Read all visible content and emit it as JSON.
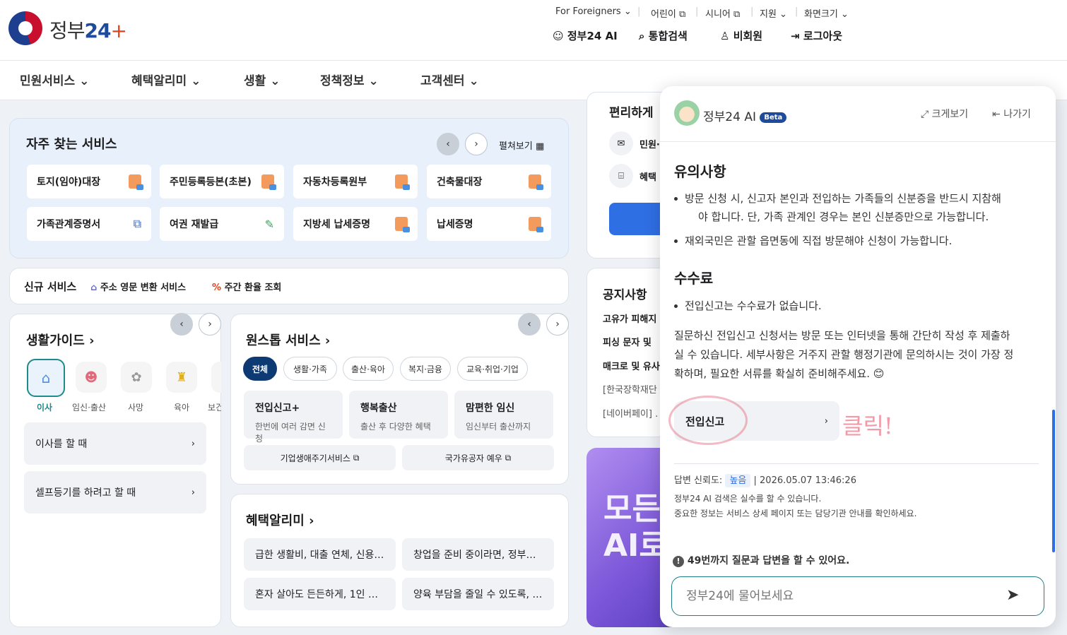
{
  "header": {
    "brand_text": "정부",
    "brand_num": "24",
    "brand_plus": "+",
    "util": [
      "For Foreigners",
      "어린이",
      "시니어",
      "지원",
      "화면크기"
    ],
    "main": [
      "정부24 AI",
      "통합검색",
      "비회원",
      "로그아웃"
    ]
  },
  "gnb": [
    "민원서비스",
    "혜택알리미",
    "생활",
    "정책정보",
    "고객센터"
  ],
  "fav": {
    "title": "자주 찾는 서비스",
    "expand": "펼쳐보기",
    "tiles": [
      "토지(임야)대장",
      "주민등록등본(초본)",
      "자동차등록원부",
      "건축물대장",
      "가족관계증명서",
      "여권 재발급",
      "지방세 납세증명",
      "납세증명"
    ]
  },
  "newsvc": {
    "label": "신규 서비스",
    "items": [
      "주소 영문 변환 서비스",
      "주간 환율 조회"
    ]
  },
  "guide": {
    "title": "생활가이드",
    "cats": [
      "이사",
      "임신·출산",
      "사망",
      "육아",
      "보건"
    ],
    "items": [
      "이사를 할 때",
      "셀프등기를 하려고 할 때"
    ]
  },
  "onestop": {
    "title": "원스톱 서비스",
    "filters": [
      "전체",
      "생활·가족",
      "출산·육아",
      "복지·금융",
      "교육·취업·기업"
    ],
    "cards": [
      {
        "t": "전입신고+",
        "d": "한번에 여러 감면 신청"
      },
      {
        "t": "행복출산",
        "d": "출산 후 다양한 혜택"
      },
      {
        "t": "맘편한 임신",
        "d": "임신부터 출산까지"
      }
    ],
    "links": [
      "기업생애주기서비스",
      "국가유공자 예우"
    ]
  },
  "benefit": {
    "title": "혜택알리미",
    "items": [
      "급한 생활비, 대출 연체, 신용…",
      "창업을 준비 중이라면, 정부…",
      "혼자 살아도 든든하게, 1인 …",
      "양육 부담을 줄일 수 있도록, …"
    ]
  },
  "right": {
    "conv": "편리하게",
    "conv_items": [
      "민원·",
      "혜택"
    ],
    "notice": "공지사항",
    "notice_items": [
      "고유가 피해지",
      "피싱 문자 및 ",
      "매크로 및 유사",
      "[한국장학재단",
      "[네이버페이] ."
    ],
    "banner": [
      "모든",
      "AI로"
    ]
  },
  "ai": {
    "title": "정부24 AI",
    "badge": "Beta",
    "expand": "크게보기",
    "exit": "나가기",
    "h1": "유의사항",
    "b1": [
      "방문 신청 시, 신고자 본인과 전입하는 가족들의 신분증을 반드시 지참해",
      "야 합니다. 단, 가족 관계인 경우는 본인 신분증만으로 가능합니다.",
      "재외국민은 관할 읍면동에 직접 방문해야 신청이 가능합니다."
    ],
    "h2": "수수료",
    "b2": "전입신고는 수수료가 없습니다.",
    "p": [
      "질문하신 전입신고 신청서는 방문 또는 인터넷을 통해 간단히 작성 후 제출하",
      "실 수 있습니다. 세부사항은 거주지 관할 행정기관에 문의하시는 것이 가장 정",
      "확하며, 필요한 서류를 확실히 준비해주세요. 😊"
    ],
    "link": "전입신고",
    "annot": "클릭!",
    "reliab_label": "답변 신뢰도:",
    "reliab": "높음",
    "ts": "| 2026.05.07 13:46:26",
    "disc": [
      "정부24 AI 검색은 실수를 할 수 있습니다.",
      "중요한 정보는 서비스 상세 페이지 또는 담당기관 안내를 확인하세요."
    ],
    "limit": "49번까지 질문과 답변을 할 수 있어요.",
    "placeholder": "정부24에 물어보세요"
  }
}
